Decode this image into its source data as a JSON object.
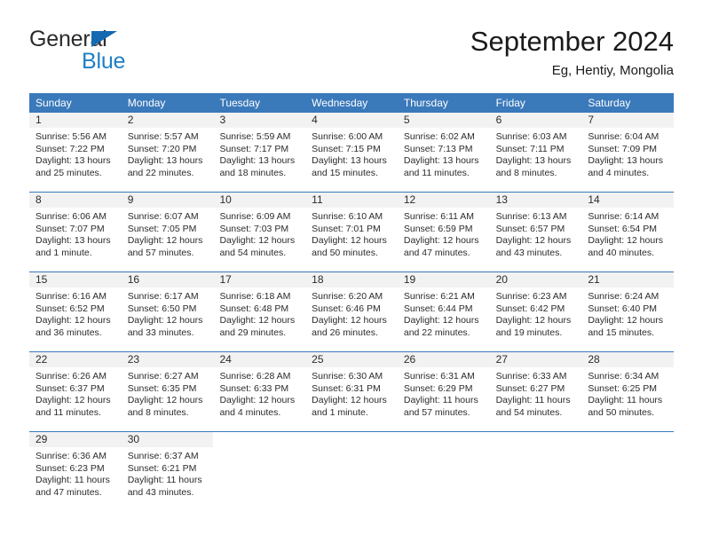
{
  "brand": {
    "name_part1": "General",
    "name_part2": "Blue",
    "flag_icon": "triangle-flag-icon",
    "colors": {
      "general_text": "#2b2b2b",
      "blue_text": "#1f7fc4",
      "flag": "#1469b0"
    }
  },
  "header": {
    "title": "September 2024",
    "subtitle": "Eg, Hentiy, Mongolia"
  },
  "theme": {
    "header_row_bg": "#3a79ba",
    "header_row_text": "#ffffff",
    "daynum_bg": "#f2f2f2",
    "row_divider": "#3a79ba",
    "body_text": "#2b2b2b"
  },
  "weekdays": [
    "Sunday",
    "Monday",
    "Tuesday",
    "Wednesday",
    "Thursday",
    "Friday",
    "Saturday"
  ],
  "weeks": [
    [
      {
        "day": "1",
        "sunrise": "Sunrise: 5:56 AM",
        "sunset": "Sunset: 7:22 PM",
        "daylight1": "Daylight: 13 hours",
        "daylight2": "and 25 minutes."
      },
      {
        "day": "2",
        "sunrise": "Sunrise: 5:57 AM",
        "sunset": "Sunset: 7:20 PM",
        "daylight1": "Daylight: 13 hours",
        "daylight2": "and 22 minutes."
      },
      {
        "day": "3",
        "sunrise": "Sunrise: 5:59 AM",
        "sunset": "Sunset: 7:17 PM",
        "daylight1": "Daylight: 13 hours",
        "daylight2": "and 18 minutes."
      },
      {
        "day": "4",
        "sunrise": "Sunrise: 6:00 AM",
        "sunset": "Sunset: 7:15 PM",
        "daylight1": "Daylight: 13 hours",
        "daylight2": "and 15 minutes."
      },
      {
        "day": "5",
        "sunrise": "Sunrise: 6:02 AM",
        "sunset": "Sunset: 7:13 PM",
        "daylight1": "Daylight: 13 hours",
        "daylight2": "and 11 minutes."
      },
      {
        "day": "6",
        "sunrise": "Sunrise: 6:03 AM",
        "sunset": "Sunset: 7:11 PM",
        "daylight1": "Daylight: 13 hours",
        "daylight2": "and 8 minutes."
      },
      {
        "day": "7",
        "sunrise": "Sunrise: 6:04 AM",
        "sunset": "Sunset: 7:09 PM",
        "daylight1": "Daylight: 13 hours",
        "daylight2": "and 4 minutes."
      }
    ],
    [
      {
        "day": "8",
        "sunrise": "Sunrise: 6:06 AM",
        "sunset": "Sunset: 7:07 PM",
        "daylight1": "Daylight: 13 hours",
        "daylight2": "and 1 minute."
      },
      {
        "day": "9",
        "sunrise": "Sunrise: 6:07 AM",
        "sunset": "Sunset: 7:05 PM",
        "daylight1": "Daylight: 12 hours",
        "daylight2": "and 57 minutes."
      },
      {
        "day": "10",
        "sunrise": "Sunrise: 6:09 AM",
        "sunset": "Sunset: 7:03 PM",
        "daylight1": "Daylight: 12 hours",
        "daylight2": "and 54 minutes."
      },
      {
        "day": "11",
        "sunrise": "Sunrise: 6:10 AM",
        "sunset": "Sunset: 7:01 PM",
        "daylight1": "Daylight: 12 hours",
        "daylight2": "and 50 minutes."
      },
      {
        "day": "12",
        "sunrise": "Sunrise: 6:11 AM",
        "sunset": "Sunset: 6:59 PM",
        "daylight1": "Daylight: 12 hours",
        "daylight2": "and 47 minutes."
      },
      {
        "day": "13",
        "sunrise": "Sunrise: 6:13 AM",
        "sunset": "Sunset: 6:57 PM",
        "daylight1": "Daylight: 12 hours",
        "daylight2": "and 43 minutes."
      },
      {
        "day": "14",
        "sunrise": "Sunrise: 6:14 AM",
        "sunset": "Sunset: 6:54 PM",
        "daylight1": "Daylight: 12 hours",
        "daylight2": "and 40 minutes."
      }
    ],
    [
      {
        "day": "15",
        "sunrise": "Sunrise: 6:16 AM",
        "sunset": "Sunset: 6:52 PM",
        "daylight1": "Daylight: 12 hours",
        "daylight2": "and 36 minutes."
      },
      {
        "day": "16",
        "sunrise": "Sunrise: 6:17 AM",
        "sunset": "Sunset: 6:50 PM",
        "daylight1": "Daylight: 12 hours",
        "daylight2": "and 33 minutes."
      },
      {
        "day": "17",
        "sunrise": "Sunrise: 6:18 AM",
        "sunset": "Sunset: 6:48 PM",
        "daylight1": "Daylight: 12 hours",
        "daylight2": "and 29 minutes."
      },
      {
        "day": "18",
        "sunrise": "Sunrise: 6:20 AM",
        "sunset": "Sunset: 6:46 PM",
        "daylight1": "Daylight: 12 hours",
        "daylight2": "and 26 minutes."
      },
      {
        "day": "19",
        "sunrise": "Sunrise: 6:21 AM",
        "sunset": "Sunset: 6:44 PM",
        "daylight1": "Daylight: 12 hours",
        "daylight2": "and 22 minutes."
      },
      {
        "day": "20",
        "sunrise": "Sunrise: 6:23 AM",
        "sunset": "Sunset: 6:42 PM",
        "daylight1": "Daylight: 12 hours",
        "daylight2": "and 19 minutes."
      },
      {
        "day": "21",
        "sunrise": "Sunrise: 6:24 AM",
        "sunset": "Sunset: 6:40 PM",
        "daylight1": "Daylight: 12 hours",
        "daylight2": "and 15 minutes."
      }
    ],
    [
      {
        "day": "22",
        "sunrise": "Sunrise: 6:26 AM",
        "sunset": "Sunset: 6:37 PM",
        "daylight1": "Daylight: 12 hours",
        "daylight2": "and 11 minutes."
      },
      {
        "day": "23",
        "sunrise": "Sunrise: 6:27 AM",
        "sunset": "Sunset: 6:35 PM",
        "daylight1": "Daylight: 12 hours",
        "daylight2": "and 8 minutes."
      },
      {
        "day": "24",
        "sunrise": "Sunrise: 6:28 AM",
        "sunset": "Sunset: 6:33 PM",
        "daylight1": "Daylight: 12 hours",
        "daylight2": "and 4 minutes."
      },
      {
        "day": "25",
        "sunrise": "Sunrise: 6:30 AM",
        "sunset": "Sunset: 6:31 PM",
        "daylight1": "Daylight: 12 hours",
        "daylight2": "and 1 minute."
      },
      {
        "day": "26",
        "sunrise": "Sunrise: 6:31 AM",
        "sunset": "Sunset: 6:29 PM",
        "daylight1": "Daylight: 11 hours",
        "daylight2": "and 57 minutes."
      },
      {
        "day": "27",
        "sunrise": "Sunrise: 6:33 AM",
        "sunset": "Sunset: 6:27 PM",
        "daylight1": "Daylight: 11 hours",
        "daylight2": "and 54 minutes."
      },
      {
        "day": "28",
        "sunrise": "Sunrise: 6:34 AM",
        "sunset": "Sunset: 6:25 PM",
        "daylight1": "Daylight: 11 hours",
        "daylight2": "and 50 minutes."
      }
    ],
    [
      {
        "day": "29",
        "sunrise": "Sunrise: 6:36 AM",
        "sunset": "Sunset: 6:23 PM",
        "daylight1": "Daylight: 11 hours",
        "daylight2": "and 47 minutes."
      },
      {
        "day": "30",
        "sunrise": "Sunrise: 6:37 AM",
        "sunset": "Sunset: 6:21 PM",
        "daylight1": "Daylight: 11 hours",
        "daylight2": "and 43 minutes."
      },
      {
        "day": "",
        "sunrise": "",
        "sunset": "",
        "daylight1": "",
        "daylight2": ""
      },
      {
        "day": "",
        "sunrise": "",
        "sunset": "",
        "daylight1": "",
        "daylight2": ""
      },
      {
        "day": "",
        "sunrise": "",
        "sunset": "",
        "daylight1": "",
        "daylight2": ""
      },
      {
        "day": "",
        "sunrise": "",
        "sunset": "",
        "daylight1": "",
        "daylight2": ""
      },
      {
        "day": "",
        "sunrise": "",
        "sunset": "",
        "daylight1": "",
        "daylight2": ""
      }
    ]
  ]
}
